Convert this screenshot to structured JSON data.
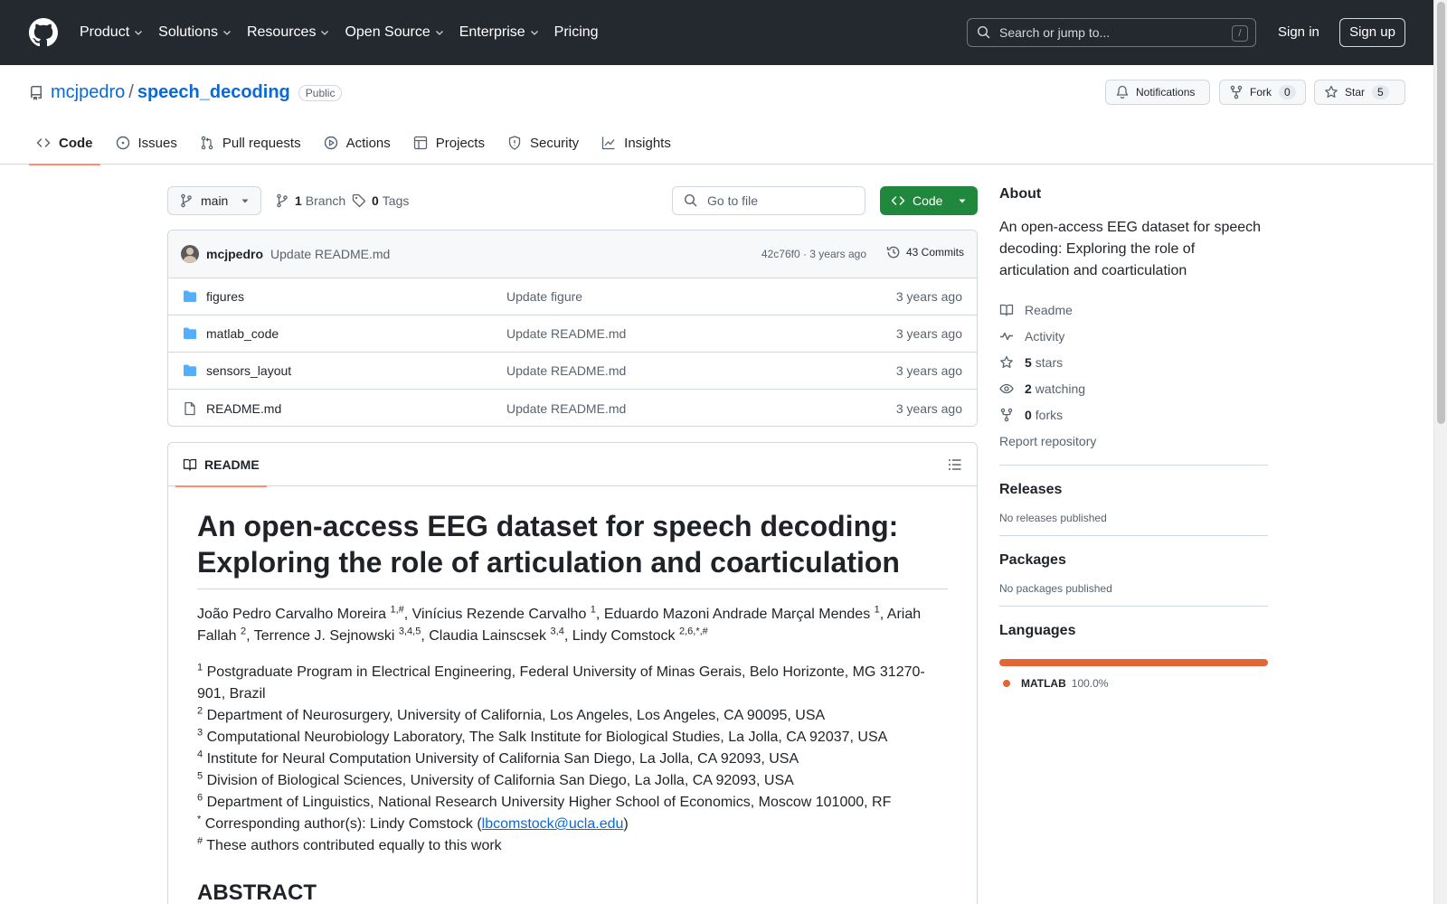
{
  "header": {
    "nav": [
      {
        "label": "Product",
        "has_menu": true
      },
      {
        "label": "Solutions",
        "has_menu": true
      },
      {
        "label": "Resources",
        "has_menu": true
      },
      {
        "label": "Open Source",
        "has_menu": true
      },
      {
        "label": "Enterprise",
        "has_menu": true
      },
      {
        "label": "Pricing",
        "has_menu": false
      }
    ],
    "search_placeholder": "Search or jump to...",
    "search_shortcut": "/",
    "sign_in": "Sign in",
    "sign_up": "Sign up"
  },
  "repo": {
    "owner": "mcjpedro",
    "separator": "/",
    "name": "speech_decoding",
    "visibility": "Public",
    "notifications_label": "Notifications",
    "fork_label": "Fork",
    "fork_count": "0",
    "star_label": "Star",
    "star_count": "5"
  },
  "tabs": [
    {
      "label": "Code",
      "icon": "code-icon",
      "active": true
    },
    {
      "label": "Issues",
      "icon": "issue-icon",
      "active": false
    },
    {
      "label": "Pull requests",
      "icon": "pull-request-icon",
      "active": false
    },
    {
      "label": "Actions",
      "icon": "play-icon",
      "active": false
    },
    {
      "label": "Projects",
      "icon": "table-icon",
      "active": false
    },
    {
      "label": "Security",
      "icon": "shield-icon",
      "active": false
    },
    {
      "label": "Insights",
      "icon": "graph-icon",
      "active": false
    }
  ],
  "toolbar": {
    "branch": "main",
    "branch_count": "1",
    "branch_label": "Branch",
    "tag_count": "0",
    "tag_label": "Tags",
    "goto_placeholder": "Go to file",
    "code_button": "Code"
  },
  "commit": {
    "author": "mcjpedro",
    "message": "Update README.md",
    "meta": "42c76f0 · 3 years ago",
    "count_label": "43 Commits"
  },
  "files": [
    {
      "type": "folder",
      "name": "figures",
      "message": "Update figure",
      "date": "3 years ago"
    },
    {
      "type": "folder",
      "name": "matlab_code",
      "message": "Update README.md",
      "date": "3 years ago"
    },
    {
      "type": "folder",
      "name": "sensors_layout",
      "message": "Update README.md",
      "date": "3 years ago"
    },
    {
      "type": "file",
      "name": "README.md",
      "message": "Update README.md",
      "date": "3 years ago"
    }
  ],
  "readme": {
    "tab_label": "README",
    "title": "An open-access EEG dataset for speech decoding: Exploring the role of articulation and coarticulation",
    "authors": [
      {
        "name": "João Pedro Carvalho Moreira",
        "sup": "1,#",
        "after": ", "
      },
      {
        "name": "Vinícius Rezende Carvalho",
        "sup": "1",
        "after": ", "
      },
      {
        "name": "Eduardo Mazoni Andrade Marçal Mendes",
        "sup": "1",
        "after": ", "
      },
      {
        "name": "Ariah Fallah",
        "sup": "2",
        "after": ", "
      },
      {
        "name": "Terrence J. Sejnowski",
        "sup": "3,4,5",
        "after": ", "
      },
      {
        "name": "Claudia Lainscsek",
        "sup": "3,4",
        "after": ", "
      },
      {
        "name": "Lindy Comstock",
        "sup": "2,6,*,#",
        "after": ""
      }
    ],
    "affiliations": [
      {
        "sup": "1",
        "text": "Postgraduate Program in Electrical Engineering, Federal University of Minas Gerais, Belo Horizonte, MG 31270-901, Brazil"
      },
      {
        "sup": "2",
        "text": "Department of Neurosurgery, University of California, Los Angeles, Los Angeles, CA 90095, USA"
      },
      {
        "sup": "3",
        "text": "Computational Neurobiology Laboratory, The Salk Institute for Biological Studies, La Jolla, CA 92037, USA"
      },
      {
        "sup": "4",
        "text": "Institute for Neural Computation University of California San Diego, La Jolla, CA 92093, USA"
      },
      {
        "sup": "5",
        "text": "Division of Biological Sciences, University of California San Diego, La Jolla, CA 92093, USA"
      },
      {
        "sup": "6",
        "text": "Department of Linguistics, National Research University Higher School of Economics, Moscow 101000, RF"
      }
    ],
    "corresponding_sup": "*",
    "corresponding_prefix": "Corresponding author(s): Lindy Comstock (",
    "corresponding_email": "lbcomstock@ucla.edu",
    "corresponding_suffix": ")",
    "equal_sup": "#",
    "equal_text": "These authors contributed equally to this work",
    "abstract_heading": "ABSTRACT"
  },
  "sidebar": {
    "about_heading": "About",
    "description": "An open-access EEG dataset for speech decoding: Exploring the role of articulation and coarticulation",
    "links": [
      {
        "icon": "book-icon",
        "count": "",
        "label": "Readme"
      },
      {
        "icon": "pulse-icon",
        "count": "",
        "label": "Activity"
      },
      {
        "icon": "star-icon",
        "count": "5",
        "label": "stars"
      },
      {
        "icon": "eye-icon",
        "count": "2",
        "label": "watching"
      },
      {
        "icon": "fork-icon",
        "count": "0",
        "label": "forks"
      }
    ],
    "report": "Report repository",
    "releases_heading": "Releases",
    "releases_text": "No releases published",
    "packages_heading": "Packages",
    "packages_text": "No packages published",
    "languages_heading": "Languages",
    "language": {
      "name": "MATLAB",
      "percent": "100.0%",
      "color": "#e16737",
      "share": 1.0
    }
  },
  "colors": {
    "header_bg": "#24292f",
    "link": "#0969da",
    "code_button": "#1f883d",
    "active_tab_underline": "#fd8c73",
    "folder_icon": "#54aeff"
  }
}
